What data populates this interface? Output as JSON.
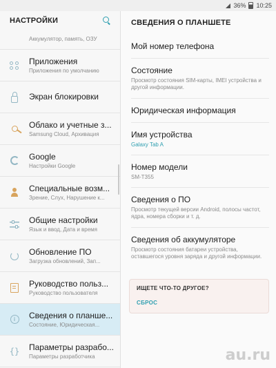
{
  "status_bar": {
    "battery_text": "36%",
    "time": "10:25"
  },
  "left_pane": {
    "title": "НАСТРОЙКИ",
    "items": [
      {
        "label": "",
        "sub": "Аккумулятор, память, ОЗУ",
        "icon": "device-maintenance-icon"
      },
      {
        "label": "Приложения",
        "sub": "Приложения по умолчанию",
        "icon": "apps-icon"
      },
      {
        "label": "Экран блокировки",
        "sub": "",
        "icon": "lock-icon"
      },
      {
        "label": "Облако и учетные з...",
        "sub": "Samsung Cloud, Архивация",
        "icon": "key-icon"
      },
      {
        "label": "Google",
        "sub": "Настройки Google",
        "icon": "google-icon"
      },
      {
        "label": "Специальные возм...",
        "sub": "Зрение, Слух, Нарушение к...",
        "icon": "accessibility-icon"
      },
      {
        "label": "Общие настройки",
        "sub": "Язык и ввод, Дата и время",
        "icon": "sliders-icon"
      },
      {
        "label": "Обновление ПО",
        "sub": "Загрузка обновлений, Зап...",
        "icon": "refresh-icon"
      },
      {
        "label": "Руководство польз...",
        "sub": "Руководство пользователя",
        "icon": "manual-icon"
      },
      {
        "label": "Сведения о планше...",
        "sub": "Состояние, Юридическая...",
        "icon": "info-icon"
      },
      {
        "label": "Параметры разрабо...",
        "sub": "Параметры разработчика",
        "icon": "braces-icon"
      }
    ]
  },
  "right_pane": {
    "title": "СВЕДЕНИЯ О ПЛАНШЕТЕ",
    "items": [
      {
        "label": "Мой номер телефона"
      },
      {
        "label": "Состояние",
        "sub": "Просмотр состояния SIM-карты, IMEI устройства и другой информации."
      },
      {
        "label": "Юридическая информация"
      },
      {
        "label": "Имя устройства",
        "value": "Galaxy Tab A"
      },
      {
        "label": "Номер модели",
        "sub": "SM-T355"
      },
      {
        "label": "Сведения о ПО",
        "sub": "Просмотр текущей версии Android, полосы частот, ядра, номера сборки и т. д."
      },
      {
        "label": "Сведения об аккумуляторе",
        "sub": "Просмотр состояния батареи устройства, оставшегося уровня заряда и другой информации."
      }
    ],
    "suggestion": {
      "title": "ИЩЕТЕ ЧТО-ТО ДРУГОЕ?",
      "link": "СБРОС"
    }
  },
  "watermark": "au.ru",
  "colors": {
    "accent": "#2f9fb0",
    "selected_bg": "#d7ecf5",
    "icon_orange": "#d8a45e"
  }
}
